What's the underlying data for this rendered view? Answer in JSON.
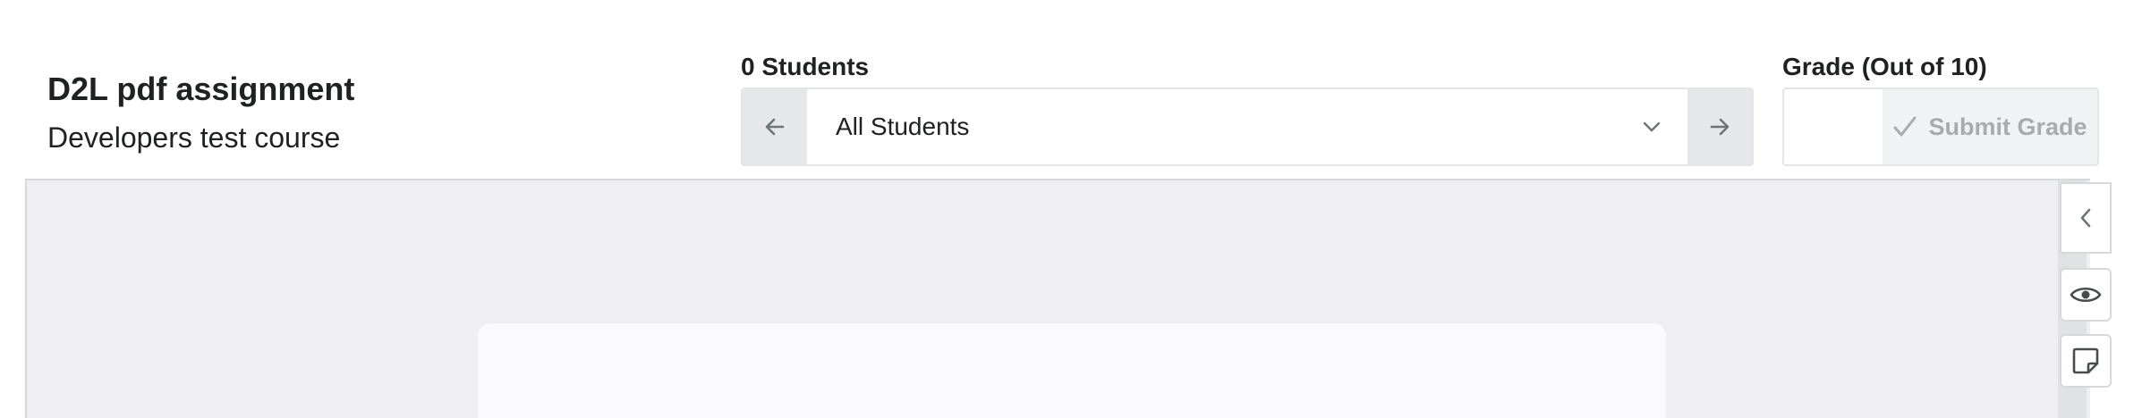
{
  "header": {
    "title": "D2L pdf assignment",
    "subtitle": "Developers test course"
  },
  "students": {
    "count_label": "0 Students",
    "selected": "All Students",
    "prev_icon": "arrow-left-icon",
    "next_icon": "arrow-right-icon",
    "dropdown_icon": "chevron-down-icon"
  },
  "grade": {
    "label": "Grade (Out of 10)",
    "value": "",
    "submit_label": "Submit Grade",
    "submit_icon": "checkmark-icon"
  },
  "sidebar": {
    "collapse_icon": "chevron-left-icon",
    "view_icon": "eye-icon",
    "note_icon": "sticky-note-icon"
  },
  "colors": {
    "text": "#202122",
    "disabled_text": "#a8abae",
    "viewer_bg": "#efeff1",
    "nav_button_bg": "#e6e7e9"
  }
}
